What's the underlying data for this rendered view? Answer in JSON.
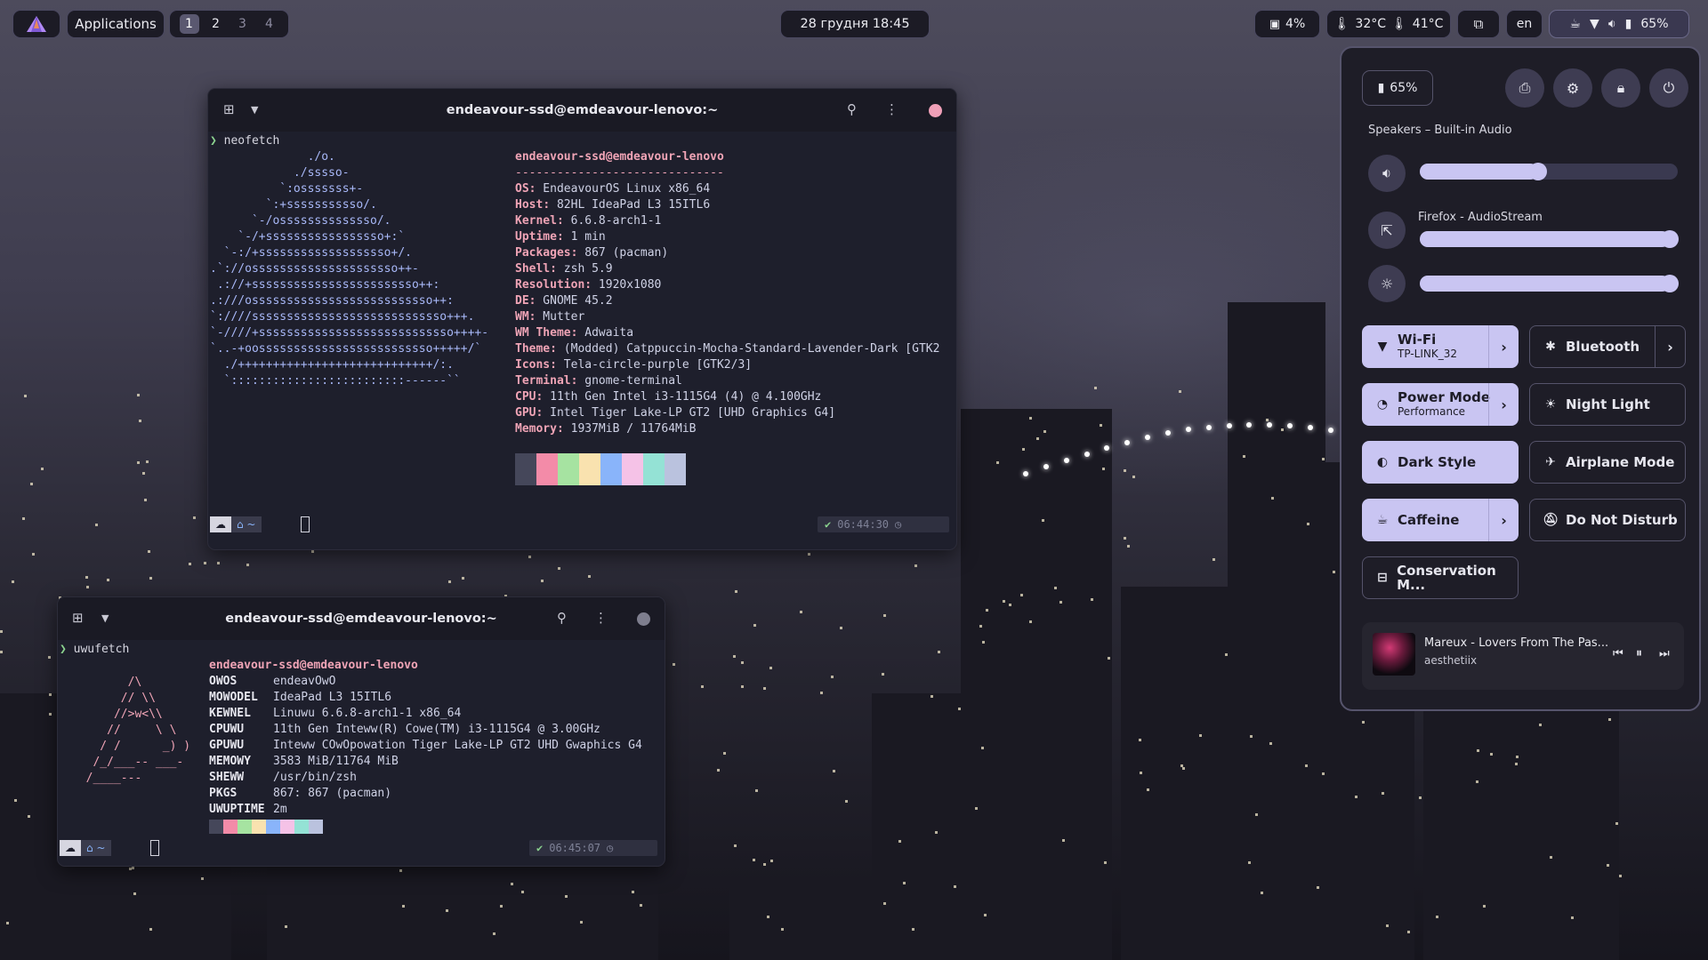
{
  "topbar": {
    "apps_label": "Applications",
    "workspaces": [
      "1",
      "2",
      "3",
      "4"
    ],
    "datetime": "28 грудня  18:45",
    "cpu": "4%",
    "temp1": "32°C",
    "temp2": "41°C",
    "lang": "en",
    "battery": "65%"
  },
  "term1": {
    "title": "endeavour-ssd@emdeavour-lenovo:~",
    "command": "neofetch",
    "ascii": [
      "              ./o.",
      "            ./sssso-",
      "          `:osssssss+-",
      "        `:+sssssssssso/.",
      "      `-/ossssssssssssso/.",
      "    `-/+sssssssssssssssso+:`",
      "  `-:/+sssssssssssssssssso+/.",
      ".`://osssssssssssssssssssso++-",
      " .://+ssssssssssssssssssssssso++:",
      ".:///ossssssssssssssssssssssssso++:",
      "`:////ssssssssssssssssssssssssssso+++.",
      "`-////+ssssssssssssssssssssssssssso++++-",
      "`..-+oosssssssssssssssssssssssso+++++/`",
      "  ./++++++++++++++++++++++++++++/:.",
      "  `:::::::::::::::::::::::::------``"
    ],
    "user": "endeavour-ssd@emdeavour-lenovo",
    "separator": "------------------------------",
    "info": [
      {
        "k": "OS",
        "v": " EndeavourOS Linux x86_64"
      },
      {
        "k": "Host",
        "v": " 82HL IdeaPad L3 15ITL6"
      },
      {
        "k": "Kernel",
        "v": " 6.6.8-arch1-1"
      },
      {
        "k": "Uptime",
        "v": " 1 min"
      },
      {
        "k": "Packages",
        "v": " 867 (pacman)"
      },
      {
        "k": "Shell",
        "v": " zsh 5.9"
      },
      {
        "k": "Resolution",
        "v": " 1920x1080"
      },
      {
        "k": "DE",
        "v": " GNOME 45.2"
      },
      {
        "k": "WM",
        "v": " Mutter"
      },
      {
        "k": "WM Theme",
        "v": " Adwaita"
      },
      {
        "k": "Theme",
        "v": " (Modded) Catppuccin-Mocha-Standard-Lavender-Dark [GTK2"
      },
      {
        "k": "Icons",
        "v": " Tela-circle-purple [GTK2/3]"
      },
      {
        "k": "Terminal",
        "v": " gnome-terminal"
      },
      {
        "k": "CPU",
        "v": " 11th Gen Intel i3-1115G4 (4) @ 4.100GHz"
      },
      {
        "k": "GPU",
        "v": " Intel Tiger Lake-LP GT2 [UHD Graphics G4]"
      },
      {
        "k": "Memory",
        "v": " 1937MiB / 11764MiB"
      }
    ],
    "palette": [
      "#45475a",
      "#f38ba8",
      "#a6e3a1",
      "#f9e2af",
      "#89b4fa",
      "#f5c2e7",
      "#94e2d5",
      "#bac2de"
    ],
    "time": "06:44:30"
  },
  "term2": {
    "title": "endeavour-ssd@emdeavour-lenovo:~",
    "command": "uwufetch",
    "ascii": [
      "        /\\",
      "       // \\\\",
      "      //>w<\\\\",
      "     //     \\ \\",
      "    / /      _) )",
      "   /_/___-- ___-",
      "  /____---"
    ],
    "user": "endeavour-ssd@emdeavour-lenovo",
    "info": [
      {
        "k": "OWOS",
        "v": "endeavOwO"
      },
      {
        "k": "MOWODEL",
        "v": "IdeaPad L3 15ITL6"
      },
      {
        "k": "KEWNEL",
        "v": "Linuwu 6.6.8-arch1-1 x86_64"
      },
      {
        "k": "CPUWU",
        "v": "11th Gen Inteww(R) Cowe(TM) i3-1115G4 @ 3.00GHz"
      },
      {
        "k": "GPUWU",
        "v": "Inteww COwOpowation Tiger Lake-LP GT2 UHD Gwaphics G4"
      },
      {
        "k": "MEMOWY",
        "v": "3583 MiB/11764 MiB"
      },
      {
        "k": "SHEWW",
        "v": "/usr/bin/zsh"
      },
      {
        "k": "PKGS",
        "v": "867: 867 (pacman)"
      },
      {
        "k": "UWUPTIME",
        "v": "2m"
      }
    ],
    "palette": [
      "#45475a",
      "#f38ba8",
      "#a6e3a1",
      "#f9e2af",
      "#89b4fa",
      "#f5c2e7",
      "#94e2d5",
      "#bac2de"
    ],
    "time": "06:45:07"
  },
  "quicksettings": {
    "battery": "65%",
    "audio_device": "Speakers – Built-in Audio",
    "stream_label": "Firefox - AudioStream",
    "volume_level": 0.46,
    "stream_level": 0.97,
    "brightness_level": 0.97,
    "toggles": [
      {
        "label": "Wi-Fi",
        "sub": "TP-LINK_32",
        "icon": "wifi-icon",
        "on": true,
        "arrow": true
      },
      {
        "label": "Bluetooth",
        "sub": "",
        "icon": "bluetooth-icon",
        "on": false,
        "arrow": true
      },
      {
        "label": "Power Mode",
        "sub": "Performance",
        "icon": "power-mode-icon",
        "on": true,
        "arrow": true
      },
      {
        "label": "Night Light",
        "sub": "",
        "icon": "night-light-icon",
        "on": false,
        "arrow": false
      },
      {
        "label": "Dark Style",
        "sub": "",
        "icon": "dark-style-icon",
        "on": true,
        "arrow": false
      },
      {
        "label": "Airplane Mode",
        "sub": "",
        "icon": "airplane-icon",
        "on": false,
        "arrow": false
      },
      {
        "label": "Caffeine",
        "sub": "",
        "icon": "caffeine-icon",
        "on": true,
        "arrow": true
      },
      {
        "label": "Do Not Disturb",
        "sub": "",
        "icon": "do-not-disturb-icon",
        "on": false,
        "arrow": false
      },
      {
        "label": "Conservation M...",
        "sub": "",
        "icon": "conservation-icon",
        "on": false,
        "arrow": false
      }
    ],
    "media": {
      "title": "Mareux - Lovers From The Pas...",
      "artist": "aesthetiix"
    }
  }
}
